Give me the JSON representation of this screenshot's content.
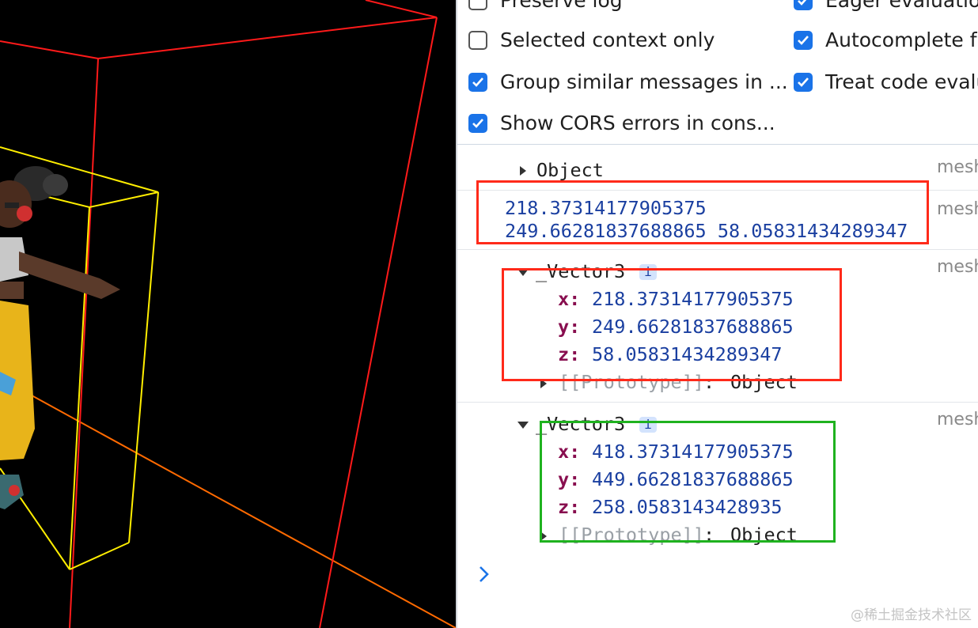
{
  "settings": {
    "preserve_log": {
      "label": "Preserve log",
      "checked": false
    },
    "eager_evaluation": {
      "label": "Eager evaluation",
      "checked": true
    },
    "selected_context_only": {
      "label": "Selected context only",
      "checked": false
    },
    "autocomplete": {
      "label": "Autocomplete fr",
      "checked": true
    },
    "group_similar": {
      "label": "Group similar messages in ...",
      "checked": true
    },
    "treat_code": {
      "label": "Treat code evalu",
      "checked": true
    },
    "show_cors": {
      "label": "Show CORS errors in cons...",
      "checked": true
    }
  },
  "console": {
    "entry1": {
      "label": "Object",
      "source": "mesh"
    },
    "entry2": {
      "line1": "218.37314177905375",
      "line2": "249.66281837688865 58.05831434289347",
      "source": "mesh"
    },
    "entry3": {
      "label": "_Vector3",
      "badge": "i",
      "source": "mesh",
      "x_key": "x:",
      "x": "218.37314177905375",
      "y_key": "y:",
      "y": "249.66281837688865",
      "z_key": "z:",
      "z": "58.05831434289347",
      "proto_key": "[[Prototype]]",
      "proto_sep": ":",
      "proto_value": "Object"
    },
    "entry4": {
      "label": "_Vector3",
      "badge": "i",
      "source": "mesh",
      "x_key": "x:",
      "x": "418.37314177905375",
      "y_key": "y:",
      "y": "449.66281837688865",
      "z_key": "z:",
      "z": "258.0583143428935",
      "proto_key": "[[Prototype]]",
      "proto_sep": ":",
      "proto_value": "Object"
    },
    "prompt_icon": "chevron-right-icon"
  },
  "colors": {
    "accent": "#1a73e8",
    "highlight_red": "#ff2a1a",
    "highlight_green": "#1fb21f"
  },
  "watermark": "@稀土掘金技术社区"
}
